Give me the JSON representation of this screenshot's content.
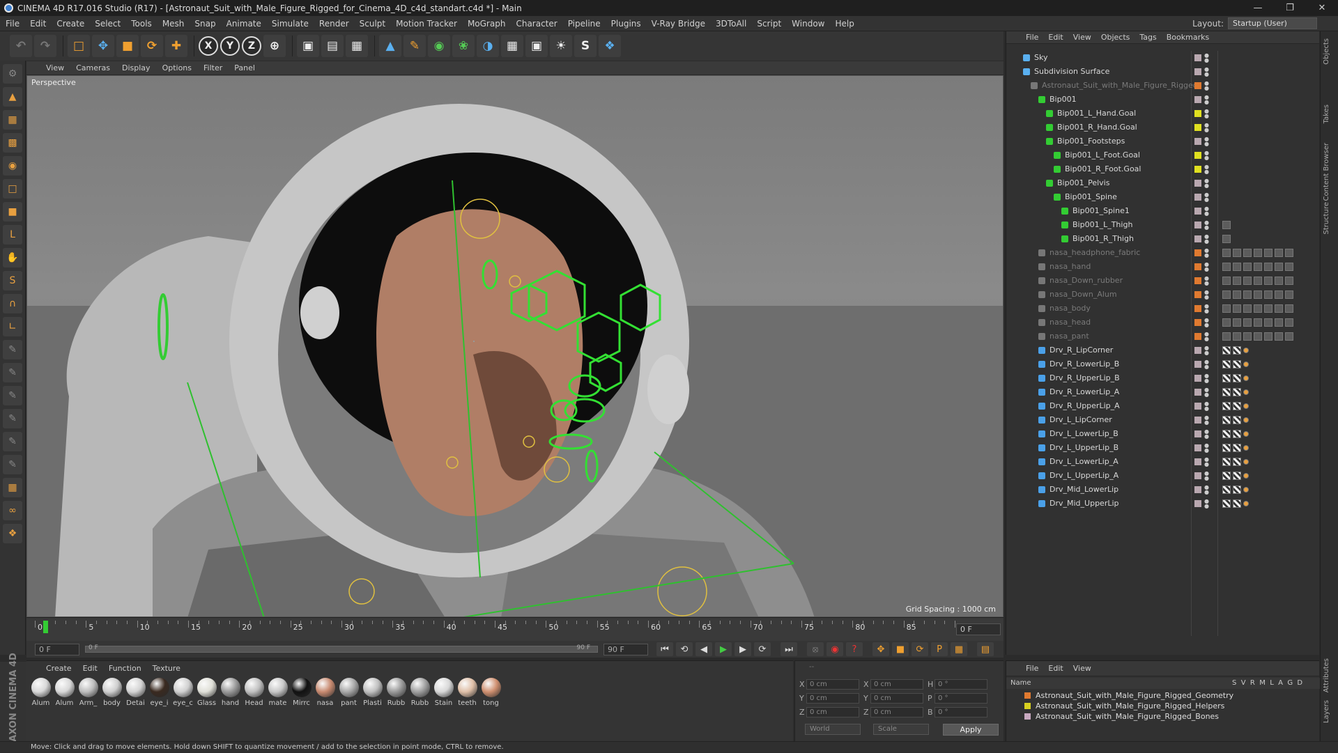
{
  "window": {
    "title": "CINEMA 4D R17.016 Studio (R17) - [Astronaut_Suit_with_Male_Figure_Rigged_for_Cinema_4D_c4d_standart.c4d *] - Main",
    "layout_label": "Layout:",
    "layout_value": "Startup (User)"
  },
  "menubar": [
    "File",
    "Edit",
    "Create",
    "Select",
    "Tools",
    "Mesh",
    "Snap",
    "Animate",
    "Simulate",
    "Render",
    "Sculpt",
    "Motion Tracker",
    "MoGraph",
    "Character",
    "Pipeline",
    "Plugins",
    "V-Ray Bridge",
    "3DToAll",
    "Script",
    "Window",
    "Help"
  ],
  "viewport": {
    "menu": [
      "View",
      "Cameras",
      "Display",
      "Options",
      "Filter",
      "Panel"
    ],
    "label": "Perspective",
    "grid_spacing": "Grid Spacing : 1000 cm"
  },
  "timeline": {
    "ticks": [
      "0",
      "5",
      "10",
      "15",
      "20",
      "25",
      "30",
      "35",
      "40",
      "45",
      "50",
      "55",
      "60",
      "65",
      "70",
      "75",
      "80",
      "85",
      "90"
    ],
    "current_frame": "0 F",
    "start_frame": "0 F",
    "preview_start": "0 F",
    "preview_end": "90 F",
    "end_frame": "90 F"
  },
  "materials": {
    "menu": [
      "Create",
      "Edit",
      "Function",
      "Texture"
    ],
    "items": [
      "Alum",
      "Alum",
      "Arm_",
      "body",
      "Detai",
      "eye_i",
      "eye_c",
      "Glass",
      "hand",
      "Head",
      "mate",
      "Mirrc",
      "nasa",
      "pant",
      "Plasti",
      "Rubb",
      "Rubb",
      "Stain",
      "teeth",
      "tong"
    ]
  },
  "coordinates": {
    "rows": [
      {
        "l1": "X",
        "v1": "0 cm",
        "l2": "X",
        "v2": "0 cm",
        "l3": "H",
        "v3": "0 °"
      },
      {
        "l1": "Y",
        "v1": "0 cm",
        "l2": "Y",
        "v2": "0 cm",
        "l3": "P",
        "v3": "0 °"
      },
      {
        "l1": "Z",
        "v1": "0 cm",
        "l2": "Z",
        "v2": "0 cm",
        "l3": "B",
        "v3": "0 °"
      }
    ],
    "space": "World",
    "mode": "Scale",
    "apply": "Apply",
    "header": "--"
  },
  "objects": {
    "menu": [
      "File",
      "Edit",
      "View",
      "Objects",
      "Tags",
      "Bookmarks"
    ],
    "items": [
      {
        "name": "Sky",
        "indent": 0,
        "dim": false
      },
      {
        "name": "Subdivision Surface",
        "indent": 0,
        "dim": false
      },
      {
        "name": "Astronaut_Suit_with_Male_Figure_Rigged",
        "indent": 1,
        "dim": true
      },
      {
        "name": "Bip001",
        "indent": 2,
        "dim": false
      },
      {
        "name": "Bip001_L_Hand.Goal",
        "indent": 3,
        "dim": false
      },
      {
        "name": "Bip001_R_Hand.Goal",
        "indent": 3,
        "dim": false
      },
      {
        "name": "Bip001_Footsteps",
        "indent": 3,
        "dim": false
      },
      {
        "name": "Bip001_L_Foot.Goal",
        "indent": 4,
        "dim": false
      },
      {
        "name": "Bip001_R_Foot.Goal",
        "indent": 4,
        "dim": false
      },
      {
        "name": "Bip001_Pelvis",
        "indent": 3,
        "dim": false
      },
      {
        "name": "Bip001_Spine",
        "indent": 4,
        "dim": false
      },
      {
        "name": "Bip001_Spine1",
        "indent": 5,
        "dim": false
      },
      {
        "name": "Bip001_L_Thigh",
        "indent": 5,
        "dim": false
      },
      {
        "name": "Bip001_R_Thigh",
        "indent": 5,
        "dim": false
      },
      {
        "name": "nasa_headphone_fabric",
        "indent": 2,
        "dim": true
      },
      {
        "name": "nasa_hand",
        "indent": 2,
        "dim": true
      },
      {
        "name": "nasa_Down_rubber",
        "indent": 2,
        "dim": true
      },
      {
        "name": "nasa_Down_Alum",
        "indent": 2,
        "dim": true
      },
      {
        "name": "nasa_body",
        "indent": 2,
        "dim": true
      },
      {
        "name": "nasa_head",
        "indent": 2,
        "dim": true
      },
      {
        "name": "nasa_pant",
        "indent": 2,
        "dim": true
      },
      {
        "name": "Drv_R_LipCorner",
        "indent": 2,
        "dim": false
      },
      {
        "name": "Drv_R_LowerLip_B",
        "indent": 2,
        "dim": false
      },
      {
        "name": "Drv_R_UpperLip_B",
        "indent": 2,
        "dim": false
      },
      {
        "name": "Drv_R_LowerLip_A",
        "indent": 2,
        "dim": false
      },
      {
        "name": "Drv_R_UpperLip_A",
        "indent": 2,
        "dim": false
      },
      {
        "name": "Drv_L_LipCorner",
        "indent": 2,
        "dim": false
      },
      {
        "name": "Drv_L_LowerLip_B",
        "indent": 2,
        "dim": false
      },
      {
        "name": "Drv_L_UpperLip_B",
        "indent": 2,
        "dim": false
      },
      {
        "name": "Drv_L_LowerLip_A",
        "indent": 2,
        "dim": false
      },
      {
        "name": "Drv_L_UpperLip_A",
        "indent": 2,
        "dim": false
      },
      {
        "name": "Drv_Mid_LowerLip",
        "indent": 2,
        "dim": false
      },
      {
        "name": "Drv_Mid_UpperLip",
        "indent": 2,
        "dim": false
      }
    ]
  },
  "right_tabs": [
    "Objects",
    "Takes",
    "Content Browser",
    "Structure",
    "Attributes",
    "Layers"
  ],
  "layers": {
    "menu": [
      "File",
      "Edit",
      "View"
    ],
    "header": {
      "name": "Name",
      "cols": "S  V  R  M  L  A  G  D"
    },
    "items": [
      {
        "name": "Astronaut_Suit_with_Male_Figure_Rigged_Geometry",
        "color": "#e07a30"
      },
      {
        "name": "Astronaut_Suit_with_Male_Figure_Rigged_Helpers",
        "color": "#d8d020"
      },
      {
        "name": "Astronaut_Suit_with_Male_Figure_Rigged_Bones",
        "color": "#c8a8c0"
      }
    ]
  },
  "maxon": "MAXON CINEMA 4D",
  "status": "Move: Click and drag to move elements. Hold down SHIFT to quantize movement / add to the selection in point mode, CTRL to remove."
}
